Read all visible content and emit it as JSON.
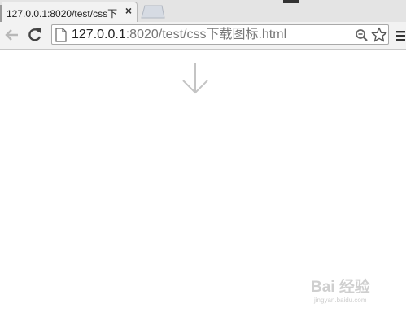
{
  "browser": {
    "tab": {
      "title": "127.0.0.1:8020/test/css下",
      "close_label": "×"
    },
    "address_bar": {
      "url_host": "127.0.0.1",
      "url_rest": ":8020/test/css下载图标.html"
    }
  },
  "watermark": {
    "logo_text": "Bai 经验",
    "url": "jingyan.baidu.com"
  },
  "icons": [
    "page-icon",
    "back-arrow-icon",
    "reload-icon",
    "zoom-icon",
    "star-icon",
    "menu-icon",
    "down-arrow-icon"
  ]
}
